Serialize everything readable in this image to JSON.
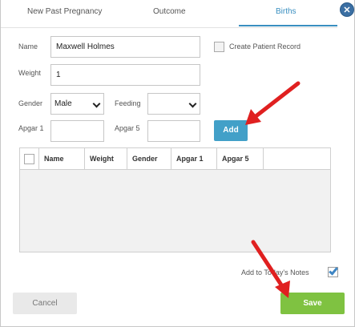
{
  "tabs": [
    {
      "label": "New Past Pregnancy"
    },
    {
      "label": "Outcome"
    },
    {
      "label": "Births"
    }
  ],
  "active_tab": "Births",
  "close_icon": "x-icon",
  "form": {
    "name_label": "Name",
    "name_value": "Maxwell Holmes",
    "weight_label": "Weight",
    "weight_value": "1",
    "gender_label": "Gender",
    "gender_value": "Male",
    "feeding_label": "Feeding",
    "feeding_value": "",
    "apgar1_label": "Apgar 1",
    "apgar1_value": "",
    "apgar5_label": "Apgar 5",
    "apgar5_value": "",
    "create_record_label": "Create Patient Record",
    "create_record_checked": false,
    "add_label": "Add"
  },
  "grid": {
    "columns": [
      "Name",
      "Weight",
      "Gender",
      "Apgar 1",
      "Apgar 5"
    ],
    "rows": []
  },
  "footer": {
    "notes_label": "Add to Today's Notes",
    "notes_checked": true,
    "cancel_label": "Cancel",
    "save_label": "Save"
  },
  "colors": {
    "accent_blue": "#42a0c8",
    "save_green": "#7fc241",
    "annotation_arrow_red": "#e02020"
  }
}
